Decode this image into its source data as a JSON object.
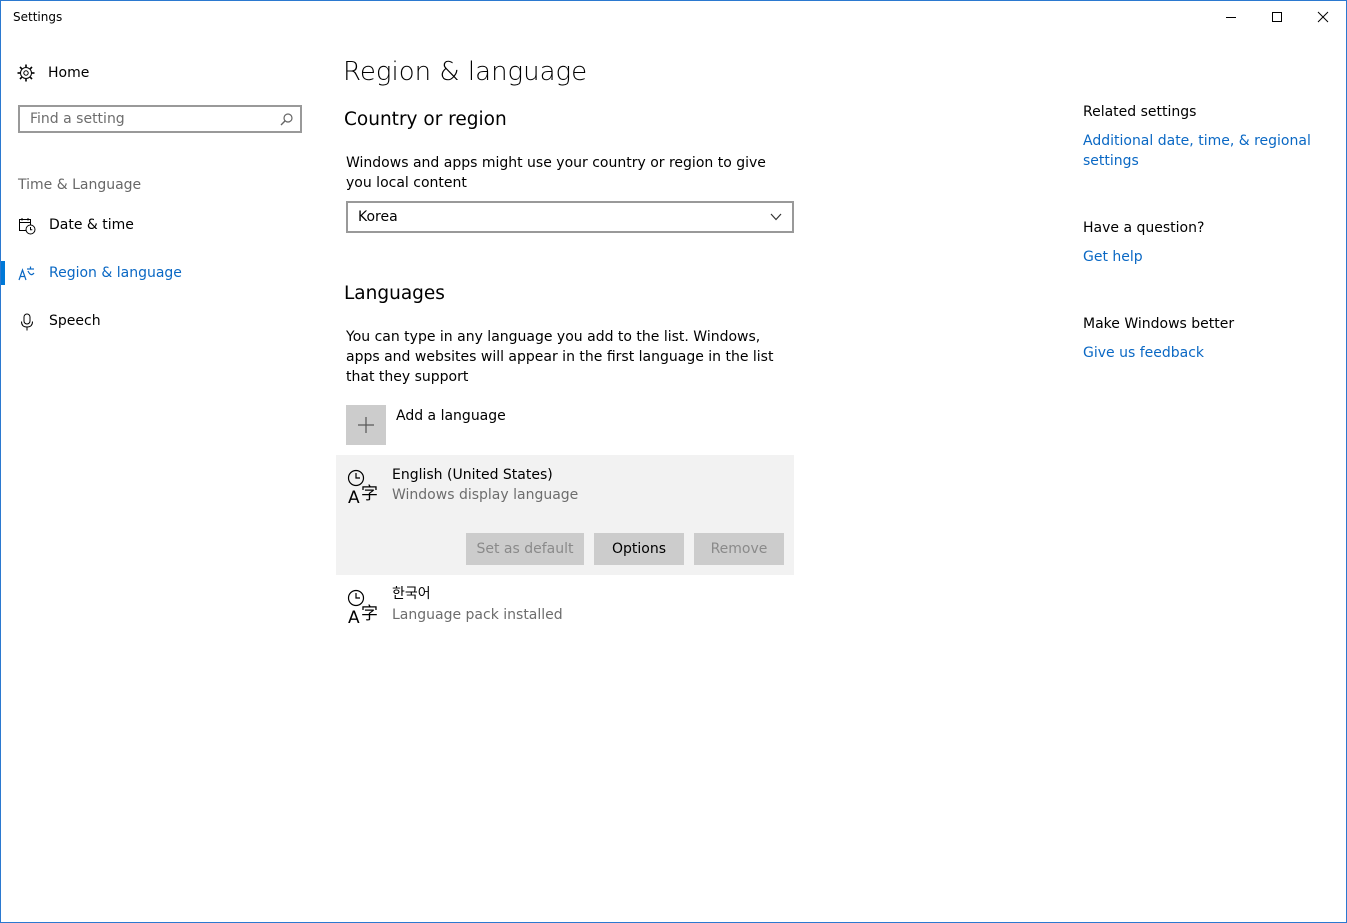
{
  "window": {
    "title": "Settings"
  },
  "sidebar": {
    "home_label": "Home",
    "search_placeholder": "Find a setting",
    "section_label": "Time & Language",
    "items": [
      {
        "label": "Date & time",
        "icon": "clock-calendar-icon",
        "selected": false
      },
      {
        "label": "Region & language",
        "icon": "region-language-icon",
        "selected": true
      },
      {
        "label": "Speech",
        "icon": "microphone-icon",
        "selected": false
      }
    ]
  },
  "main": {
    "title": "Region & language",
    "country": {
      "heading": "Country or region",
      "description": "Windows and apps might use your country or region to give you local content",
      "selected": "Korea"
    },
    "languages": {
      "heading": "Languages",
      "description": "You can type in any language you add to the list. Windows, apps and websites will appear in the first language in the list that they support",
      "add_label": "Add a language",
      "items": [
        {
          "name": "English (United States)",
          "subtitle": "Windows display language"
        },
        {
          "name": "한국어",
          "subtitle": "Language pack installed"
        }
      ],
      "actions": {
        "set_default": "Set as default",
        "options": "Options",
        "remove": "Remove"
      }
    }
  },
  "related": {
    "related_title": "Related settings",
    "related_link": "Additional date, time, & regional settings",
    "question_title": "Have a question?",
    "help_link": "Get help",
    "better_title": "Make Windows better",
    "feedback_link": "Give us feedback"
  },
  "colors": {
    "accent": "#0078d7",
    "link": "#0a68c4",
    "window_border": "#2b79d0"
  }
}
